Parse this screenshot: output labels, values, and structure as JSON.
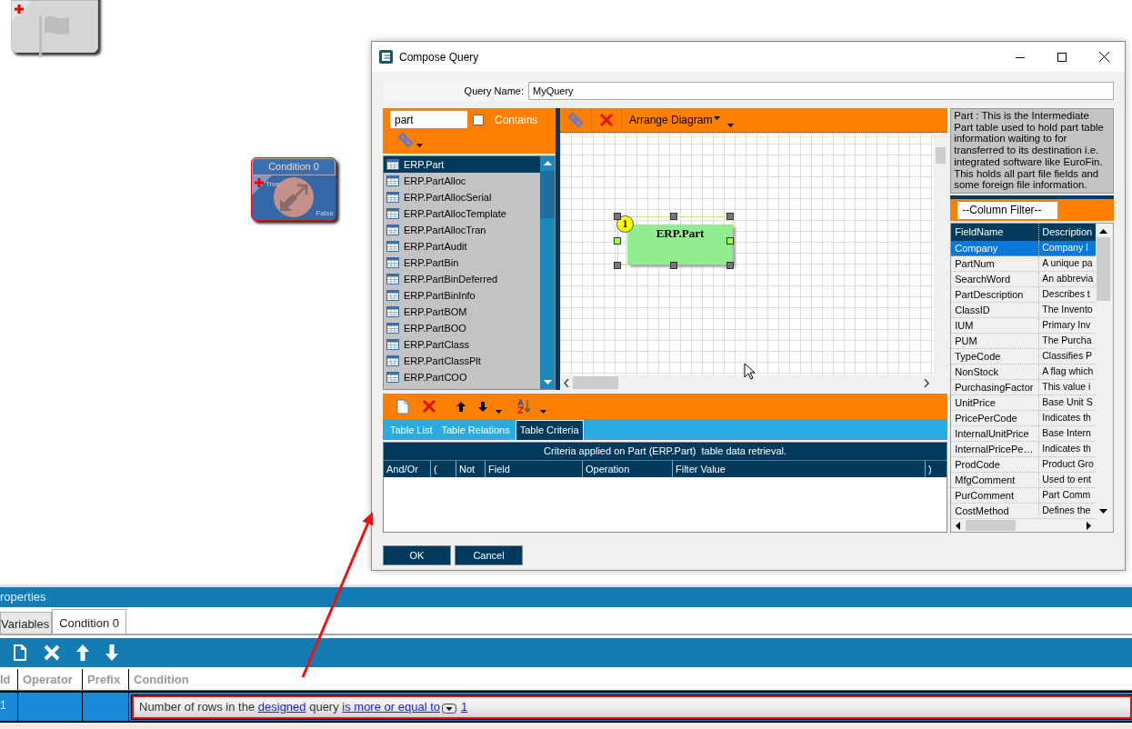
{
  "canvas_nodes": [
    {
      "kind": "start",
      "selected": false
    },
    {
      "kind": "condition",
      "title": "Condition 0",
      "true_label": "True",
      "false_label": "False",
      "selected": true
    }
  ],
  "dialog": {
    "title": "Compose Query",
    "query_name_label": "Query Name:",
    "query_name": "MyQuery",
    "table_search": {
      "value": "part",
      "contains_label": "Contains",
      "contains_checked": false
    },
    "tables": [
      {
        "name": "ERP.Part",
        "selected": true
      },
      {
        "name": "ERP.PartAlloc",
        "selected": false
      },
      {
        "name": "ERP.PartAllocSerial",
        "selected": false
      },
      {
        "name": "ERP.PartAllocTemplate",
        "selected": false
      },
      {
        "name": "ERP.PartAllocTran",
        "selected": false
      },
      {
        "name": "ERP.PartAudit",
        "selected": false
      },
      {
        "name": "ERP.PartBin",
        "selected": false
      },
      {
        "name": "ERP.PartBinDeferred",
        "selected": false
      },
      {
        "name": "ERP.PartBinInfo",
        "selected": false
      },
      {
        "name": "ERP.PartBOM",
        "selected": false
      },
      {
        "name": "ERP.PartBOO",
        "selected": false
      },
      {
        "name": "ERP.PartClass",
        "selected": false
      },
      {
        "name": "ERP.PartClassPlt",
        "selected": false
      },
      {
        "name": "ERP.PartCOO",
        "selected": false
      }
    ],
    "diagram": {
      "arrange_label": "Arrange Diagram",
      "tables": [
        {
          "name": "ERP.Part",
          "number": "1",
          "selected": true
        }
      ]
    },
    "tabs": [
      {
        "label": "Table List",
        "selected": false
      },
      {
        "label": "Table Relations",
        "selected": false
      },
      {
        "label": "Table Criteria",
        "selected": true
      }
    ],
    "criteria": {
      "caption": "Criteria applied on Part (ERP.Part)  table data retrieval.",
      "columns": [
        "And/Or",
        "(",
        "Not",
        "Field",
        "Operation",
        "Filter Value",
        ")"
      ]
    },
    "description": "Part : This is the Intermediate Part table used to hold part table information waiting to for transferred to its destination i.e. integrated software like EuroFin. This holds all part file fields and some foreign file information.",
    "column_filter": "--Column Filter--",
    "fields": {
      "columns": [
        "FieldName",
        "Description"
      ],
      "rows": [
        {
          "name": "Company",
          "description": "Company I",
          "selected": true
        },
        {
          "name": "PartNum",
          "description": "A unique pa",
          "selected": false
        },
        {
          "name": "SearchWord",
          "description": "An abbrevia",
          "selected": false
        },
        {
          "name": "PartDescription",
          "description": "Describes t",
          "selected": false
        },
        {
          "name": "ClassID",
          "description": "The Invento",
          "selected": false
        },
        {
          "name": "IUM",
          "description": "Primary Inv",
          "selected": false
        },
        {
          "name": "PUM",
          "description": "The Purcha",
          "selected": false
        },
        {
          "name": "TypeCode",
          "description": "Classifies P",
          "selected": false
        },
        {
          "name": "NonStock",
          "description": "A flag which",
          "selected": false
        },
        {
          "name": "PurchasingFactor",
          "description": "This value i",
          "selected": false
        },
        {
          "name": "UnitPrice",
          "description": "Base Unit S",
          "selected": false
        },
        {
          "name": "PricePerCode",
          "description": "Indicates th",
          "selected": false
        },
        {
          "name": "InternalUnitPrice",
          "description": "Base Intern",
          "selected": false
        },
        {
          "name": "InternalPricePe…",
          "description": "Indicates th",
          "selected": false
        },
        {
          "name": "ProdCode",
          "description": "Product Gro",
          "selected": false
        },
        {
          "name": "MfgComment",
          "description": "Used to ent",
          "selected": false
        },
        {
          "name": "PurComment",
          "description": "Part Comm",
          "selected": false
        },
        {
          "name": "CostMethod",
          "description": "Defines the",
          "selected": false
        }
      ]
    },
    "buttons": [
      "OK",
      "Cancel"
    ]
  },
  "properties": {
    "title": "roperties",
    "tabs": [
      {
        "label": "Variables",
        "selected": false
      },
      {
        "label": "Condition 0",
        "selected": true
      }
    ],
    "columns": [
      "Id",
      "Operator",
      "Prefix",
      "Condition"
    ],
    "rows": [
      {
        "id": "1",
        "selected": true,
        "condition": [
          {
            "kind": "text",
            "text": "Number of rows in the "
          },
          {
            "kind": "link",
            "text": "designed"
          },
          {
            "kind": "text",
            "text": " query "
          },
          {
            "kind": "link",
            "text": "is more or equal to"
          },
          {
            "kind": "dropdown"
          },
          {
            "kind": "link",
            "text": "1"
          }
        ]
      }
    ]
  }
}
